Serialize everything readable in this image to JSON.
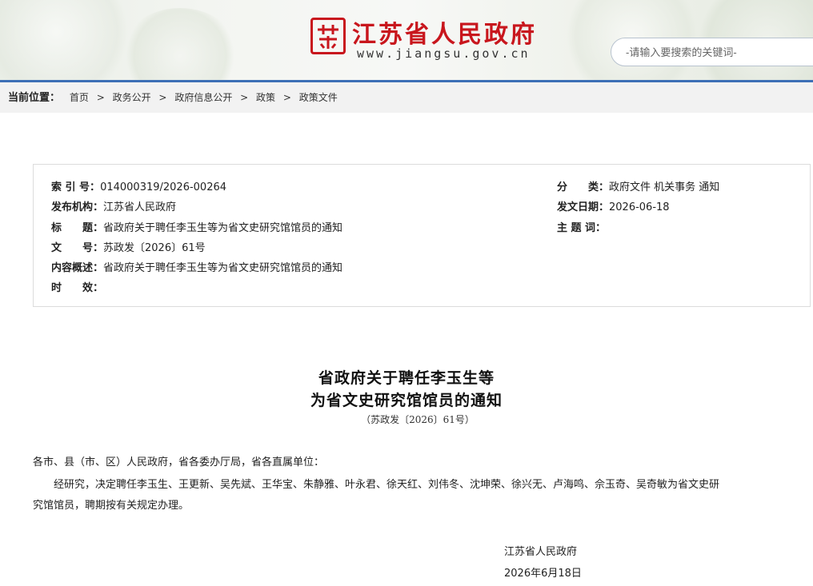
{
  "header": {
    "site_name": "江苏省人民政府",
    "site_url": "www.jiangsu.gov.cn",
    "search_placeholder": "-请输入要搜索的关键词-",
    "accent_color": "#c8161d",
    "line_color": "#3d6fb6"
  },
  "breadcrumb": {
    "label": "当前位置：",
    "items": [
      "首页",
      "政务公开",
      "政府信息公开",
      "政策",
      "政策文件"
    ],
    "separator": ">"
  },
  "info": {
    "index_key": "索 引 号：",
    "index_val": "014000319/2026-00264",
    "publisher_key": "发布机构：",
    "publisher_val": "江苏省人民政府",
    "title_key": "标　　题：",
    "title_val": "省政府关于聘任李玉生等为省文史研究馆馆员的通知",
    "docno_key": "文　　号：",
    "docno_val": "苏政发〔2026〕61号",
    "summary_key": "内容概述：",
    "summary_val": "省政府关于聘任李玉生等为省文史研究馆馆员的通知",
    "validity_key": "时　　效：",
    "validity_val": "",
    "category_key": "分　　类：",
    "category_val": "政府文件 机关事务 通知",
    "date_key": "发文日期：",
    "date_val": "2026-06-18",
    "subject_key": "主 题 词：",
    "subject_val": ""
  },
  "document": {
    "title_line1": "省政府关于聘任李玉生等",
    "title_line2": "为省文史研究馆馆员的通知",
    "doc_number": "（苏政发〔2026〕61号）",
    "addressee": "各市、县（市、区）人民政府，省各委办厅局，省各直属单位：",
    "body": "经研究，决定聘任李玉生、王更新、吴先斌、王华宝、朱静雅、叶永君、徐天红、刘伟冬、沈坤荣、徐兴无、卢海鸣、佘玉奇、吴奇敏为省文史研",
    "body_cont": "究馆馆员，聘期按有关规定办理。",
    "signer": "江苏省人民政府",
    "sign_date": "2026年6月18日"
  }
}
